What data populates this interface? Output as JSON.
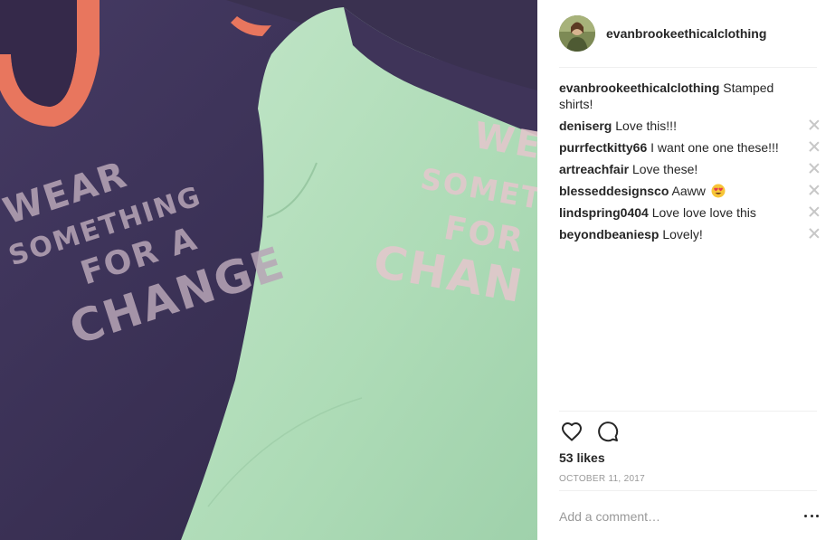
{
  "post": {
    "username": "evanbrookeethicalclothing",
    "caption_user": "evanbrookeethicalclothing",
    "caption_text": "Stamped shirts!",
    "likes": "53 likes",
    "date": "OCTOBER 11, 2017",
    "comment_placeholder": "Add a comment…"
  },
  "photo": {
    "left_shirt_lines": [
      "WEAR",
      "SOMETHING",
      "FOR A",
      "CHANGE"
    ],
    "right_shirt_lines": [
      "WE",
      "SOMETH",
      "FOR",
      "CHAN"
    ]
  },
  "comments": [
    {
      "user": "deniserg",
      "text": "Love this!!!"
    },
    {
      "user": "purrfectkitty66",
      "text": "I want one one these!!!"
    },
    {
      "user": "artreachfair",
      "text": "Love these!"
    },
    {
      "user": "blesseddesignsco",
      "text": "Aaww",
      "emoji": "heart-eyes"
    },
    {
      "user": "lindspring0404",
      "text": "Love love love this"
    },
    {
      "user": "beyondbeaniesp",
      "text": "Lovely!"
    }
  ],
  "icons": {
    "like": "heart-outline-icon",
    "comment": "speech-bubble-icon",
    "more": "ellipsis-icon",
    "remove": "close-icon"
  },
  "colors": {
    "text": "#262626",
    "muted": "#999999",
    "divider": "#efefef",
    "purple_shirt": "#3e3358",
    "mint_shirt": "#b3dcbc",
    "coral_trim": "#e8765e"
  }
}
